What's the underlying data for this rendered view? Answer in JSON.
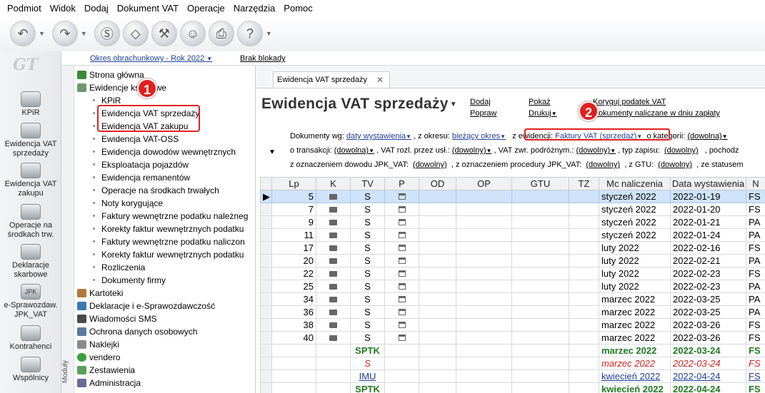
{
  "menu": [
    "Podmiot",
    "Widok",
    "Dodaj",
    "Dokument VAT",
    "Operacje",
    "Narzędzia",
    "Pomoc"
  ],
  "toolbar_icons": [
    "back-icon",
    "forward-icon",
    "money-icon",
    "eraser-icon",
    "tools-icon",
    "people-icon",
    "printer-icon",
    "help-icon"
  ],
  "logo": "GT",
  "period_link": "Okres obrachunkowy - Rok 2022",
  "break_link": "Brak blokady",
  "left_nav": [
    {
      "label": "KPiR",
      "icon": "kpir-icon"
    },
    {
      "label": "Ewidencja VAT sprzedaży",
      "icon": "vat-sales-icon"
    },
    {
      "label": "Ewidencja VAT zakupu",
      "icon": "vat-purchase-icon"
    },
    {
      "label": "Operacje na środkach trw.",
      "icon": "fixed-assets-icon"
    },
    {
      "label": "Deklaracje skarbowe",
      "icon": "tax-declarations-icon"
    },
    {
      "label": "e-Sprawozdaw. JPK_VAT",
      "icon": "jpk-icon",
      "icon_text": "JPK"
    },
    {
      "label": "Kontrahenci",
      "icon": "contractors-icon"
    },
    {
      "label": "Wspólnicy",
      "icon": "partners-icon"
    }
  ],
  "tree": {
    "top": [
      {
        "label": "Strona główna",
        "icon": "home-icon"
      },
      {
        "label": "Ewidencje księgowe",
        "icon": "ledger-icon"
      }
    ],
    "children": [
      "KPiR",
      "Ewidencja VAT sprzedaży",
      "Ewidencja VAT zakupu",
      "Ewidencja VAT-OSS",
      "Ewidencja dowodów wewnętrznych",
      "Eksploatacja pojazdów",
      "Ewidencja remanentów",
      "Operacje na środkach trwałych",
      "Noty korygujące",
      "Faktury wewnętrzne podatku należneg",
      "Korekty faktur wewnętrznych podatku",
      "Faktury wewnętrzne podatku naliczon",
      "Korekty faktur wewnętrznych podatku",
      "Rozliczenia",
      "Dokumenty firmy"
    ],
    "bottom": [
      {
        "label": "Kartoteki",
        "icon": "records-icon"
      },
      {
        "label": "Deklaracje i e-Sprawozdawczość",
        "icon": "declarations-icon"
      },
      {
        "label": "Wiadomości SMS",
        "icon": "sms-icon"
      },
      {
        "label": "Ochrona danych osobowych",
        "icon": "data-protection-icon"
      },
      {
        "label": "Naklejki",
        "icon": "stickers-icon"
      },
      {
        "label": "vendero",
        "icon": "vendero-icon"
      },
      {
        "label": "Zestawienia",
        "icon": "reports-icon"
      },
      {
        "label": "Administracja",
        "icon": "admin-icon"
      }
    ],
    "strip_label": "Moduły"
  },
  "tab_label": "Ewidencja VAT sprzedaży",
  "title": "Ewidencja VAT sprzedaży",
  "actions": {
    "dodaj": "Dodaj",
    "popraw": "Popraw",
    "pokaz": "Pokaż",
    "drukuj": "Drukuj",
    "koryguj": "Koryguj podatek VAT",
    "dokumenty_naliczane": "Dokumenty naliczane w dniu zapłaty"
  },
  "filters": {
    "row1": {
      "wg_label": "Dokumenty wg:",
      "wg_value": "daty wystawienia",
      "okres_label": ", z okresu:",
      "okres_value": "bieżący okres",
      "ewid_label": "z ewidencji:",
      "ewid_value": "Faktury VAT (sprzedaż)",
      "kat_label": "o kategorii:",
      "kat_value": "(dowolna)"
    },
    "row2": {
      "trans_label": "o transakcji:",
      "trans_value": "(dowolna)",
      "rozl_label": ", VAT rozl. przez usł.:",
      "rozl_value": "(dowolny)",
      "zwr_label": ", VAT zwr. podróżnym.:",
      "zwr_value": "(dowolny)",
      "typ_label": ", typ zapisu:",
      "typ_value": "(dowolny)",
      "poch_label": ", pochodz"
    },
    "row3": {
      "jpk_label": "z oznaczeniem dowodu JPK_VAT:",
      "jpk_value": "(dowolny)",
      "proc_label": ", z oznaczeniem procedury JPK_VAT:",
      "proc_value": "(dowolny)",
      "gtu_label": ", z GTU:",
      "gtu_value": "(dowolny)",
      "status_label": ", ze statusem"
    }
  },
  "grid": {
    "columns": [
      "Lp",
      "K",
      "TV",
      "P",
      "OD",
      "OP",
      "GTU",
      "TZ",
      "Mc naliczenia",
      "Data wystawienia",
      "N"
    ],
    "rows": [
      {
        "lp": "5",
        "k": true,
        "tv": "S",
        "p": true,
        "mc": "styczeń 2022",
        "data": "2022-01-19",
        "n": "FS",
        "style": "sel"
      },
      {
        "lp": "7",
        "k": true,
        "tv": "S",
        "p": true,
        "mc": "styczeń 2022",
        "data": "2022-01-20",
        "n": "FS",
        "style": ""
      },
      {
        "lp": "9",
        "k": true,
        "tv": "S",
        "p": true,
        "mc": "styczeń 2022",
        "data": "2022-01-21",
        "n": "PA",
        "style": ""
      },
      {
        "lp": "11",
        "k": true,
        "tv": "S",
        "p": true,
        "mc": "styczeń 2022",
        "data": "2022-01-24",
        "n": "PA",
        "style": ""
      },
      {
        "lp": "17",
        "k": true,
        "tv": "S",
        "p": true,
        "mc": "luty 2022",
        "data": "2022-02-16",
        "n": "FS",
        "style": ""
      },
      {
        "lp": "20",
        "k": true,
        "tv": "S",
        "p": true,
        "mc": "luty 2022",
        "data": "2022-02-21",
        "n": "PA",
        "style": ""
      },
      {
        "lp": "22",
        "k": true,
        "tv": "S",
        "p": true,
        "mc": "luty 2022",
        "data": "2022-02-23",
        "n": "FS",
        "style": ""
      },
      {
        "lp": "25",
        "k": true,
        "tv": "S",
        "p": true,
        "mc": "luty 2022",
        "data": "2022-02-23",
        "n": "PA",
        "style": ""
      },
      {
        "lp": "34",
        "k": true,
        "tv": "S",
        "p": true,
        "mc": "marzec 2022",
        "data": "2022-03-25",
        "n": "PA",
        "style": ""
      },
      {
        "lp": "36",
        "k": true,
        "tv": "S",
        "p": true,
        "mc": "marzec 2022",
        "data": "2022-03-25",
        "n": "PA",
        "style": ""
      },
      {
        "lp": "38",
        "k": true,
        "tv": "S",
        "p": true,
        "mc": "marzec 2022",
        "data": "2022-03-26",
        "n": "FS",
        "style": ""
      },
      {
        "lp": "40",
        "k": true,
        "tv": "S",
        "p": true,
        "mc": "marzec 2022",
        "data": "2022-03-26",
        "n": "FS",
        "style": ""
      },
      {
        "lp": "",
        "k": false,
        "tv": "SPTK",
        "p": false,
        "mc": "marzec 2022",
        "data": "2022-03-24",
        "n": "FS",
        "style": "green"
      },
      {
        "lp": "",
        "k": false,
        "tv": "S",
        "p": false,
        "mc": "marzec 2022",
        "data": "2022-03-24",
        "n": "FS",
        "style": "red"
      },
      {
        "lp": "",
        "k": false,
        "tv": "IMU",
        "p": false,
        "mc": "kwiecień 2022",
        "data": "2022-04-24",
        "n": "FS",
        "style": "blue"
      },
      {
        "lp": "",
        "k": false,
        "tv": "SPTK",
        "p": false,
        "mc": "kwiecień 2022",
        "data": "2022-04-24",
        "n": "FS",
        "style": "green"
      }
    ]
  },
  "badges": [
    "1",
    "2"
  ],
  "colors": {
    "accent_link": "#1f3f9a",
    "highlight": "#e02020",
    "selected_row": "#cfe3fb",
    "green_text": "#1f7a1f"
  }
}
